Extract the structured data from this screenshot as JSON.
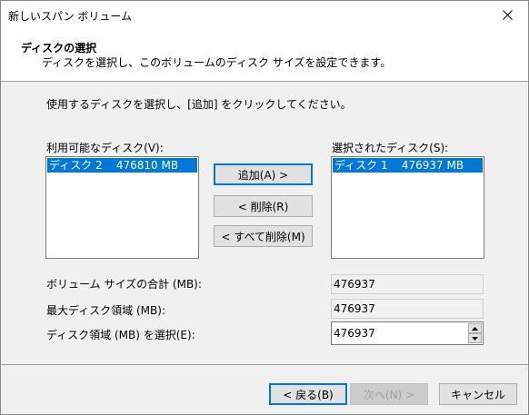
{
  "window": {
    "title": "新しいスパン ボリューム",
    "close_icon": "close-icon"
  },
  "header": {
    "title": "ディスクの選択",
    "subtitle": "ディスクを選択し、このボリュームのディスク サイズを設定できます。"
  },
  "instruction": "使用するディスクを選択し、[追加] をクリックしてください。",
  "available": {
    "label": "利用可能なディスク(V):",
    "items": [
      "ディスク 2    476810 MB"
    ]
  },
  "selected": {
    "label": "選択されたディスク(S):",
    "items": [
      "ディスク 1    476937 MB"
    ]
  },
  "buttons": {
    "add": "追加(A) >",
    "remove": "< 削除(R)",
    "remove_all": "< すべて削除(M)"
  },
  "fields": {
    "total_label": "ボリューム サイズの合計 (MB):",
    "total_value": "476937",
    "max_label": "最大ディスク領域 (MB):",
    "max_value": "476937",
    "select_label": "ディスク領域 (MB) を選択(E):",
    "select_value": "476937"
  },
  "footer": {
    "back": "< 戻る(B)",
    "next": "次へ(N) >",
    "cancel": "キャンセル"
  }
}
